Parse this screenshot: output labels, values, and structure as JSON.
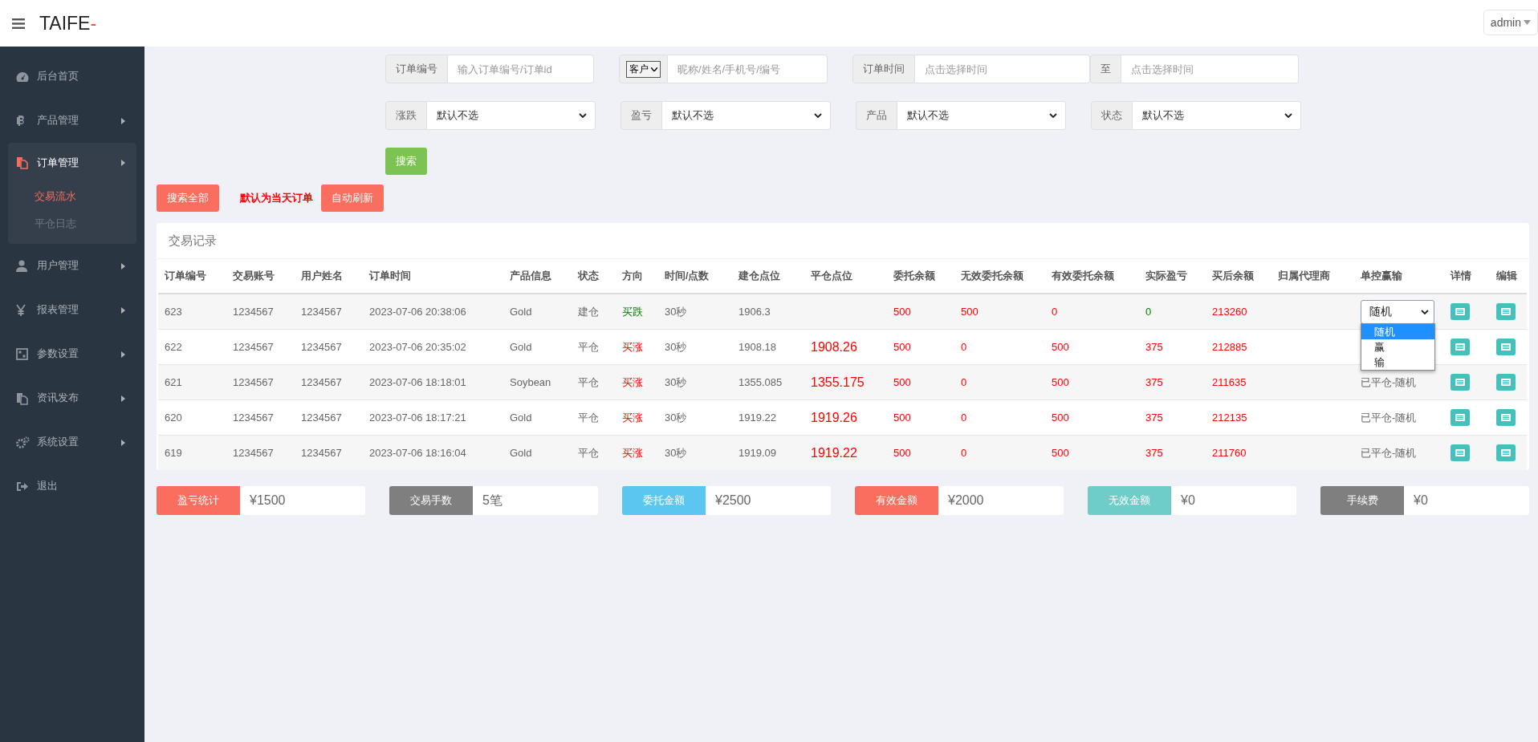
{
  "header": {
    "logo": {
      "text": "TAIFE",
      "accent": "-"
    },
    "user": "admin"
  },
  "sidebar": {
    "items": [
      {
        "label": "后台首页",
        "kind": "dashboard",
        "arrow": false,
        "expanded": false,
        "selected": false
      },
      {
        "label": "产品管理",
        "kind": "coin",
        "arrow": true,
        "expanded": false,
        "selected": false
      },
      {
        "label": "订单管理",
        "kind": "files",
        "arrow": true,
        "expanded": true,
        "selected": true,
        "children": [
          {
            "label": "交易流水",
            "selected": true
          },
          {
            "label": "平仓日志",
            "selected": false
          }
        ]
      },
      {
        "label": "用户管理",
        "kind": "user",
        "arrow": true,
        "expanded": false,
        "selected": false
      },
      {
        "label": "报表管理",
        "kind": "yen",
        "arrow": true,
        "expanded": false,
        "selected": false
      },
      {
        "label": "参数设置",
        "kind": "calculator",
        "arrow": true,
        "expanded": false,
        "selected": false
      },
      {
        "label": "资讯发布",
        "kind": "files",
        "arrow": true,
        "expanded": false,
        "selected": false
      },
      {
        "label": "系统设置",
        "kind": "gears",
        "arrow": true,
        "expanded": false,
        "selected": false
      },
      {
        "label": "退出",
        "kind": "exit",
        "arrow": false,
        "expanded": false,
        "selected": false
      }
    ]
  },
  "filters": {
    "row_1": [
      {
        "kind": "input",
        "label": "订单编号",
        "placeholder": "输入订单编号/订单id"
      },
      {
        "kind": "select-input",
        "select": "客户",
        "placeholder": "昵称/姓名/手机号/编号"
      },
      {
        "kind": "input",
        "label": "订单时间",
        "placeholder": "点击选择时间"
      },
      {
        "kind": "input",
        "label": "至",
        "placeholder": "点击选择时间"
      }
    ],
    "row_2": [
      {
        "label": "涨跌",
        "value": "默认不选"
      },
      {
        "label": "盈亏",
        "value": "默认不选"
      },
      {
        "label": "产品",
        "value": "默认不选"
      },
      {
        "label": "状态",
        "value": "默认不选"
      }
    ],
    "search_button": "搜索"
  },
  "actions": {
    "search_all": "搜索全部",
    "note": "默认为当天订单",
    "auto_refresh": "自动刷新"
  },
  "table": {
    "title": "交易记录",
    "columns": [
      {
        "label": "订单编号",
        "kind": "plain"
      },
      {
        "label": "交易账号",
        "kind": "plain"
      },
      {
        "label": "用户姓名",
        "kind": "plain"
      },
      {
        "label": "订单时间",
        "kind": "plain"
      },
      {
        "label": "产品信息",
        "kind": "plain"
      },
      {
        "label": "状态",
        "kind": "plain"
      },
      {
        "label": "方向",
        "kind": "tinted"
      },
      {
        "label": "时间/点数",
        "kind": "plain"
      },
      {
        "label": "建仓点位",
        "kind": "plain"
      },
      {
        "label": "平仓点位",
        "kind": "price"
      },
      {
        "label": "委托余额",
        "kind": "money"
      },
      {
        "label": "无效委托余额",
        "kind": "money"
      },
      {
        "label": "有效委托余额",
        "kind": "money"
      },
      {
        "label": "实际盈亏",
        "kind": "tinted"
      },
      {
        "label": "买后余额",
        "kind": "money"
      },
      {
        "label": "归属代理商",
        "kind": "plain"
      },
      {
        "label": "单控赢输",
        "kind": "outcome"
      },
      {
        "label": "详情",
        "kind": "action"
      },
      {
        "label": "编辑",
        "kind": "action"
      }
    ],
    "rows": [
      {
        "cells": [
          "623",
          "1234567",
          "1234567",
          "2023-07-06 20:38:06",
          "Gold",
          "建仓",
          {
            "text": "买跌",
            "kind": "down"
          },
          "30秒",
          "1906.3",
          null,
          "500",
          "500",
          "0",
          {
            "text": "0",
            "kind": "flat"
          },
          "213260",
          null,
          {
            "kind": "select",
            "value": "随机",
            "expanded": true,
            "options": [
              {
                "label": "随机",
                "selected": true
              },
              {
                "label": "赢",
                "selected": false
              },
              {
                "label": "输",
                "selected": false
              }
            ]
          }
        ]
      },
      {
        "cells": [
          "622",
          "1234567",
          "1234567",
          "2023-07-06 20:35:02",
          "Gold",
          "平仓",
          {
            "text": "买涨",
            "kind": "up"
          },
          "30秒",
          "1908.18",
          "1908.26",
          "500",
          "0",
          "500",
          {
            "text": "375",
            "kind": "gain"
          },
          "212885",
          null,
          null
        ]
      },
      {
        "cells": [
          "621",
          "1234567",
          "1234567",
          "2023-07-06 18:18:01",
          "Soybean",
          "平仓",
          {
            "text": "买涨",
            "kind": "up"
          },
          "30秒",
          "1355.085",
          "1355.175",
          "500",
          "0",
          "500",
          {
            "text": "375",
            "kind": "gain"
          },
          "211635",
          null,
          {
            "kind": "text",
            "text": "已平仓-随机"
          }
        ]
      },
      {
        "cells": [
          "620",
          "1234567",
          "1234567",
          "2023-07-06 18:17:21",
          "Gold",
          "平仓",
          {
            "text": "买涨",
            "kind": "up"
          },
          "30秒",
          "1919.22",
          "1919.26",
          "500",
          "0",
          "500",
          {
            "text": "375",
            "kind": "gain"
          },
          "212135",
          null,
          {
            "kind": "text",
            "text": "已平仓-随机"
          }
        ]
      },
      {
        "cells": [
          "619",
          "1234567",
          "1234567",
          "2023-07-06 18:16:04",
          "Gold",
          "平仓",
          {
            "text": "买涨",
            "kind": "up"
          },
          "30秒",
          "1919.09",
          "1919.22",
          "500",
          "0",
          "500",
          {
            "text": "375",
            "kind": "gain"
          },
          "211760",
          null,
          {
            "kind": "text",
            "text": "已平仓-随机"
          }
        ]
      }
    ]
  },
  "summary": [
    {
      "label": "盈亏统计",
      "value": "¥1500",
      "color": "#fa6e5f"
    },
    {
      "label": "交易手数",
      "value": "5笔",
      "color": "#7f7f7f"
    },
    {
      "label": "委托金额",
      "value": "¥2500",
      "color": "#5bc6ef"
    },
    {
      "label": "有效金额",
      "value": "¥2000",
      "color": "#fa6e5f"
    },
    {
      "label": "无效金额",
      "value": "¥0",
      "color": "#6fcdc8"
    },
    {
      "label": "手续费",
      "value": "¥0",
      "color": "#7f7f7f"
    }
  ]
}
